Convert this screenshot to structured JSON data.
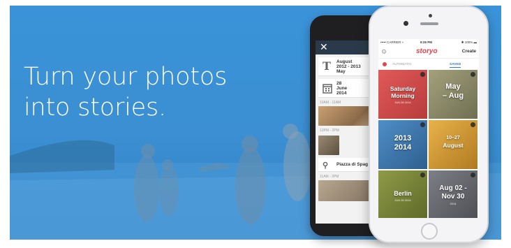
{
  "headline": {
    "line1": "Turn your photos",
    "line2": "into stories."
  },
  "colors": {
    "background": "#3b8fd2",
    "accent": "#e2434e",
    "saved_tab": "#2f7fc2"
  },
  "back_phone": {
    "close_icon": "close-icon",
    "rows": [
      {
        "icon": "T",
        "text_line1": "August",
        "text_line2": "2012 - 2013",
        "text_line3": "May"
      },
      {
        "icon": "calendar",
        "text_line1": "28",
        "text_line2": "June",
        "text_line3": "2014"
      }
    ],
    "time1": "10AM - 11AM",
    "time2": "12PM - 2PM",
    "place": "Piazza di Spag",
    "time3": "11AM - 2PM"
  },
  "front_phone": {
    "status": {
      "carrier": "••••• CARRIER ≈",
      "time": "9:25 PM",
      "battery": "✱ 100% ▬"
    },
    "app_name": "storyo",
    "create_label": "Create",
    "tabs": {
      "automatic": "AUTOMATIC",
      "saved": "SAVED"
    },
    "tiles": [
      {
        "title_line1": "Saturday",
        "title_line2": "Morning",
        "sub": "JUN 28 2014",
        "color": "#d94a4a"
      },
      {
        "title_line1": "May",
        "title_line2": "– Aug",
        "sub": "",
        "color": "#8b8a6a"
      },
      {
        "title_line1": "2013",
        "title_line2": "2014",
        "sub": "",
        "color": "#3c7ab5"
      },
      {
        "title_line1": "10–27",
        "title_line2": "August",
        "sub": "",
        "color": "#d9a23a"
      },
      {
        "title_line1": "Berlin",
        "title_line2": "",
        "sub": "JUN 28 2014",
        "color": "#7f8b3a"
      },
      {
        "title_line1": "Aug 02 -",
        "title_line2": "Nov 30",
        "sub": "2014",
        "color": "#6a6c72"
      }
    ]
  }
}
